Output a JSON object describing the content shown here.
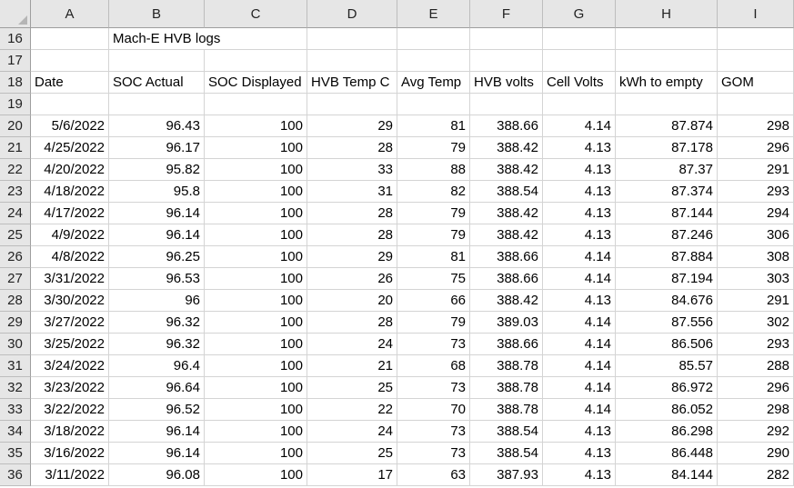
{
  "columns": [
    "A",
    "B",
    "C",
    "D",
    "E",
    "F",
    "G",
    "H",
    "I"
  ],
  "title_row": {
    "row": "16",
    "title": "Mach-E HVB logs"
  },
  "blank_rows": [
    "17",
    "19"
  ],
  "header_row": {
    "row": "18",
    "labels": [
      "Date",
      "SOC Actual",
      "SOC Displayed",
      "HVB Temp C",
      "Avg Temp",
      "HVB volts",
      "Cell Volts",
      "kWh to empty",
      "GOM"
    ]
  },
  "data_rows": [
    {
      "row": "20",
      "cells": [
        "5/6/2022",
        "96.43",
        "100",
        "29",
        "81",
        "388.66",
        "4.14",
        "87.874",
        "298"
      ]
    },
    {
      "row": "21",
      "cells": [
        "4/25/2022",
        "96.17",
        "100",
        "28",
        "79",
        "388.42",
        "4.13",
        "87.178",
        "296"
      ]
    },
    {
      "row": "22",
      "cells": [
        "4/20/2022",
        "95.82",
        "100",
        "33",
        "88",
        "388.42",
        "4.13",
        "87.37",
        "291"
      ]
    },
    {
      "row": "23",
      "cells": [
        "4/18/2022",
        "95.8",
        "100",
        "31",
        "82",
        "388.54",
        "4.13",
        "87.374",
        "293"
      ]
    },
    {
      "row": "24",
      "cells": [
        "4/17/2022",
        "96.14",
        "100",
        "28",
        "79",
        "388.42",
        "4.13",
        "87.144",
        "294"
      ]
    },
    {
      "row": "25",
      "cells": [
        "4/9/2022",
        "96.14",
        "100",
        "28",
        "79",
        "388.42",
        "4.13",
        "87.246",
        "306"
      ]
    },
    {
      "row": "26",
      "cells": [
        "4/8/2022",
        "96.25",
        "100",
        "29",
        "81",
        "388.66",
        "4.14",
        "87.884",
        "308"
      ]
    },
    {
      "row": "27",
      "cells": [
        "3/31/2022",
        "96.53",
        "100",
        "26",
        "75",
        "388.66",
        "4.14",
        "87.194",
        "303"
      ]
    },
    {
      "row": "28",
      "cells": [
        "3/30/2022",
        "96",
        "100",
        "20",
        "66",
        "388.42",
        "4.13",
        "84.676",
        "291"
      ]
    },
    {
      "row": "29",
      "cells": [
        "3/27/2022",
        "96.32",
        "100",
        "28",
        "79",
        "389.03",
        "4.14",
        "87.556",
        "302"
      ]
    },
    {
      "row": "30",
      "cells": [
        "3/25/2022",
        "96.32",
        "100",
        "24",
        "73",
        "388.66",
        "4.14",
        "86.506",
        "293"
      ]
    },
    {
      "row": "31",
      "cells": [
        "3/24/2022",
        "96.4",
        "100",
        "21",
        "68",
        "388.78",
        "4.14",
        "85.57",
        "288"
      ]
    },
    {
      "row": "32",
      "cells": [
        "3/23/2022",
        "96.64",
        "100",
        "25",
        "73",
        "388.78",
        "4.14",
        "86.972",
        "296"
      ]
    },
    {
      "row": "33",
      "cells": [
        "3/22/2022",
        "96.52",
        "100",
        "22",
        "70",
        "388.78",
        "4.14",
        "86.052",
        "298"
      ]
    },
    {
      "row": "34",
      "cells": [
        "3/18/2022",
        "96.14",
        "100",
        "24",
        "73",
        "388.54",
        "4.13",
        "86.298",
        "292"
      ]
    },
    {
      "row": "35",
      "cells": [
        "3/16/2022",
        "96.14",
        "100",
        "25",
        "73",
        "388.54",
        "4.13",
        "86.448",
        "290"
      ]
    },
    {
      "row": "36",
      "cells": [
        "3/11/2022",
        "96.08",
        "100",
        "17",
        "63",
        "387.93",
        "4.13",
        "84.144",
        "282"
      ]
    }
  ]
}
